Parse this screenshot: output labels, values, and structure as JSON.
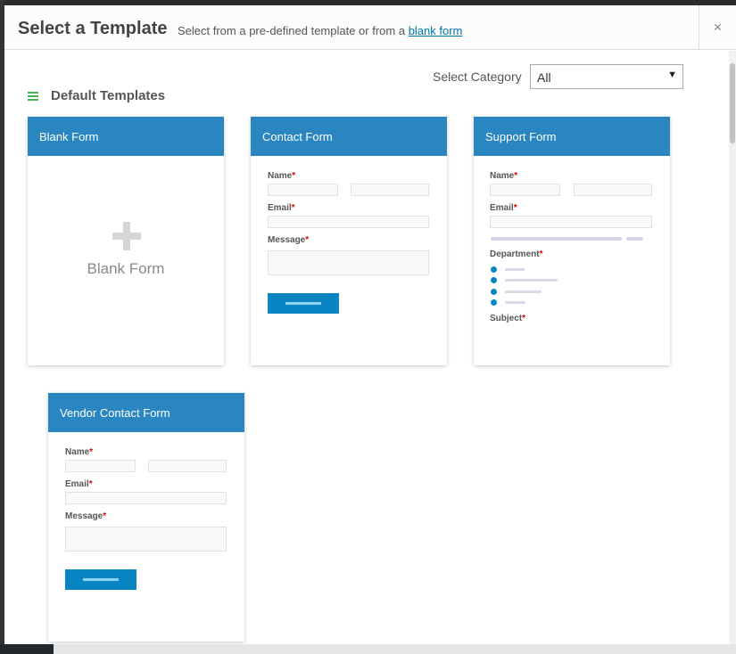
{
  "modal": {
    "title": "Select a Template",
    "subtitle_prefix": "Select from a pre-defined template or from a",
    "subtitle_link": "blank form",
    "close_symbol": "×"
  },
  "category": {
    "label": "Select Category",
    "selected": "All",
    "arrow": "▼"
  },
  "section": {
    "title": "Default Templates",
    "icon": "hamburger-icon",
    "icon_color": "#46b450"
  },
  "colors": {
    "card_header": "#2a86c0",
    "button": "#0a85c3",
    "required": "#dd0000"
  },
  "templates": [
    {
      "title": "Blank Form",
      "preview_label": "Blank Form"
    },
    {
      "title": "Contact Form",
      "fields": {
        "name": "Name",
        "email": "Email",
        "message": "Message"
      }
    },
    {
      "title": "Support Form",
      "fields": {
        "name": "Name",
        "email": "Email",
        "department": "Department",
        "subject": "Subject"
      }
    },
    {
      "title": "Vendor Contact Form",
      "fields": {
        "name": "Name",
        "email": "Email",
        "message": "Message"
      }
    }
  ],
  "required_mark": "*"
}
